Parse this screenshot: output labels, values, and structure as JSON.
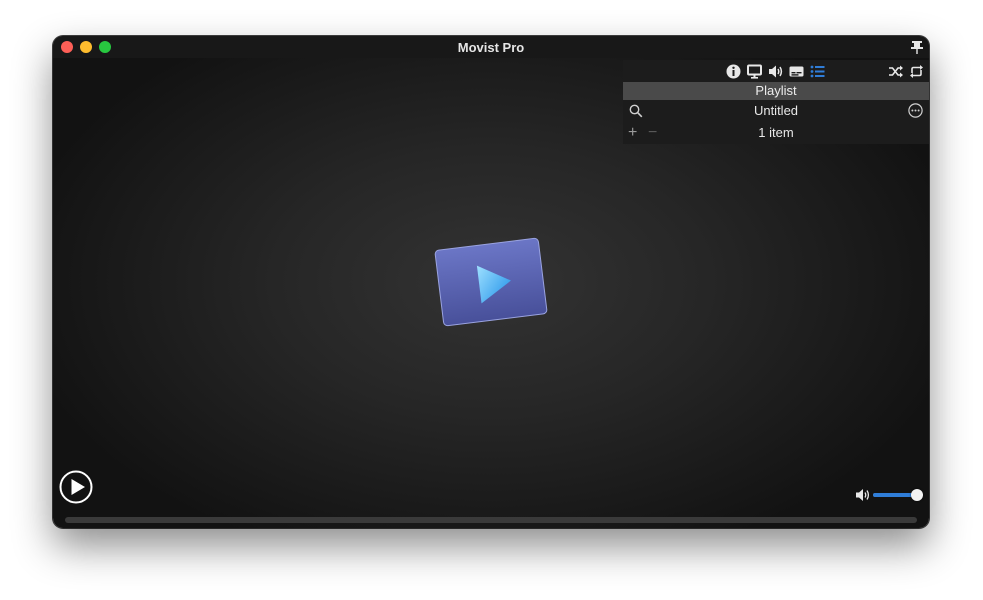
{
  "window": {
    "title": "Movist Pro"
  },
  "toolbar": {
    "icons": [
      "info-icon",
      "display-icon",
      "audio-icon",
      "subtitle-icon",
      "playlist-icon",
      "shuffle-icon",
      "repeat-icon"
    ],
    "active_icon": "playlist-icon",
    "accent_color": "#2f7dd8"
  },
  "playlist": {
    "header": "Playlist",
    "name": "Untitled",
    "count_label": "1 item",
    "add_label": "+",
    "remove_label": "−"
  },
  "volume": {
    "level": 0.9
  },
  "colors": {
    "close": "#fe5f57",
    "minimize": "#febc2e",
    "maximize": "#28c840",
    "logo_blue": "#5a64b0"
  }
}
